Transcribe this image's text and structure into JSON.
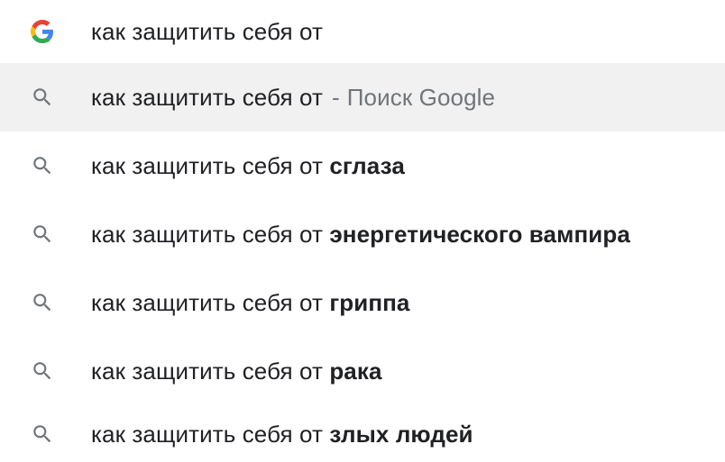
{
  "input": {
    "query": "как защитить себя от",
    "icon": "google-g-icon"
  },
  "colors": {
    "google_blue": "#4285F4",
    "google_red": "#EA4335",
    "google_yellow": "#FBBC05",
    "google_green": "#34A853",
    "highlight_bg": "#f1f1f1",
    "search_icon": "#70757a"
  },
  "suggestions": [
    {
      "prefix": "как защитить себя от",
      "separator": "-",
      "provider": "Поиск Google",
      "icon": "search-icon"
    },
    {
      "prefix": "как защитить себя от",
      "completion": "сглаза",
      "icon": "search-icon"
    },
    {
      "prefix": "как защитить себя от",
      "completion": "энергетического вампира",
      "icon": "search-icon"
    },
    {
      "prefix": "как защитить себя от",
      "completion": "гриппа",
      "icon": "search-icon"
    },
    {
      "prefix": "как защитить себя от",
      "completion": "рака",
      "icon": "search-icon"
    },
    {
      "prefix": "как защитить себя от",
      "completion": "злых людей",
      "icon": "search-icon"
    }
  ]
}
